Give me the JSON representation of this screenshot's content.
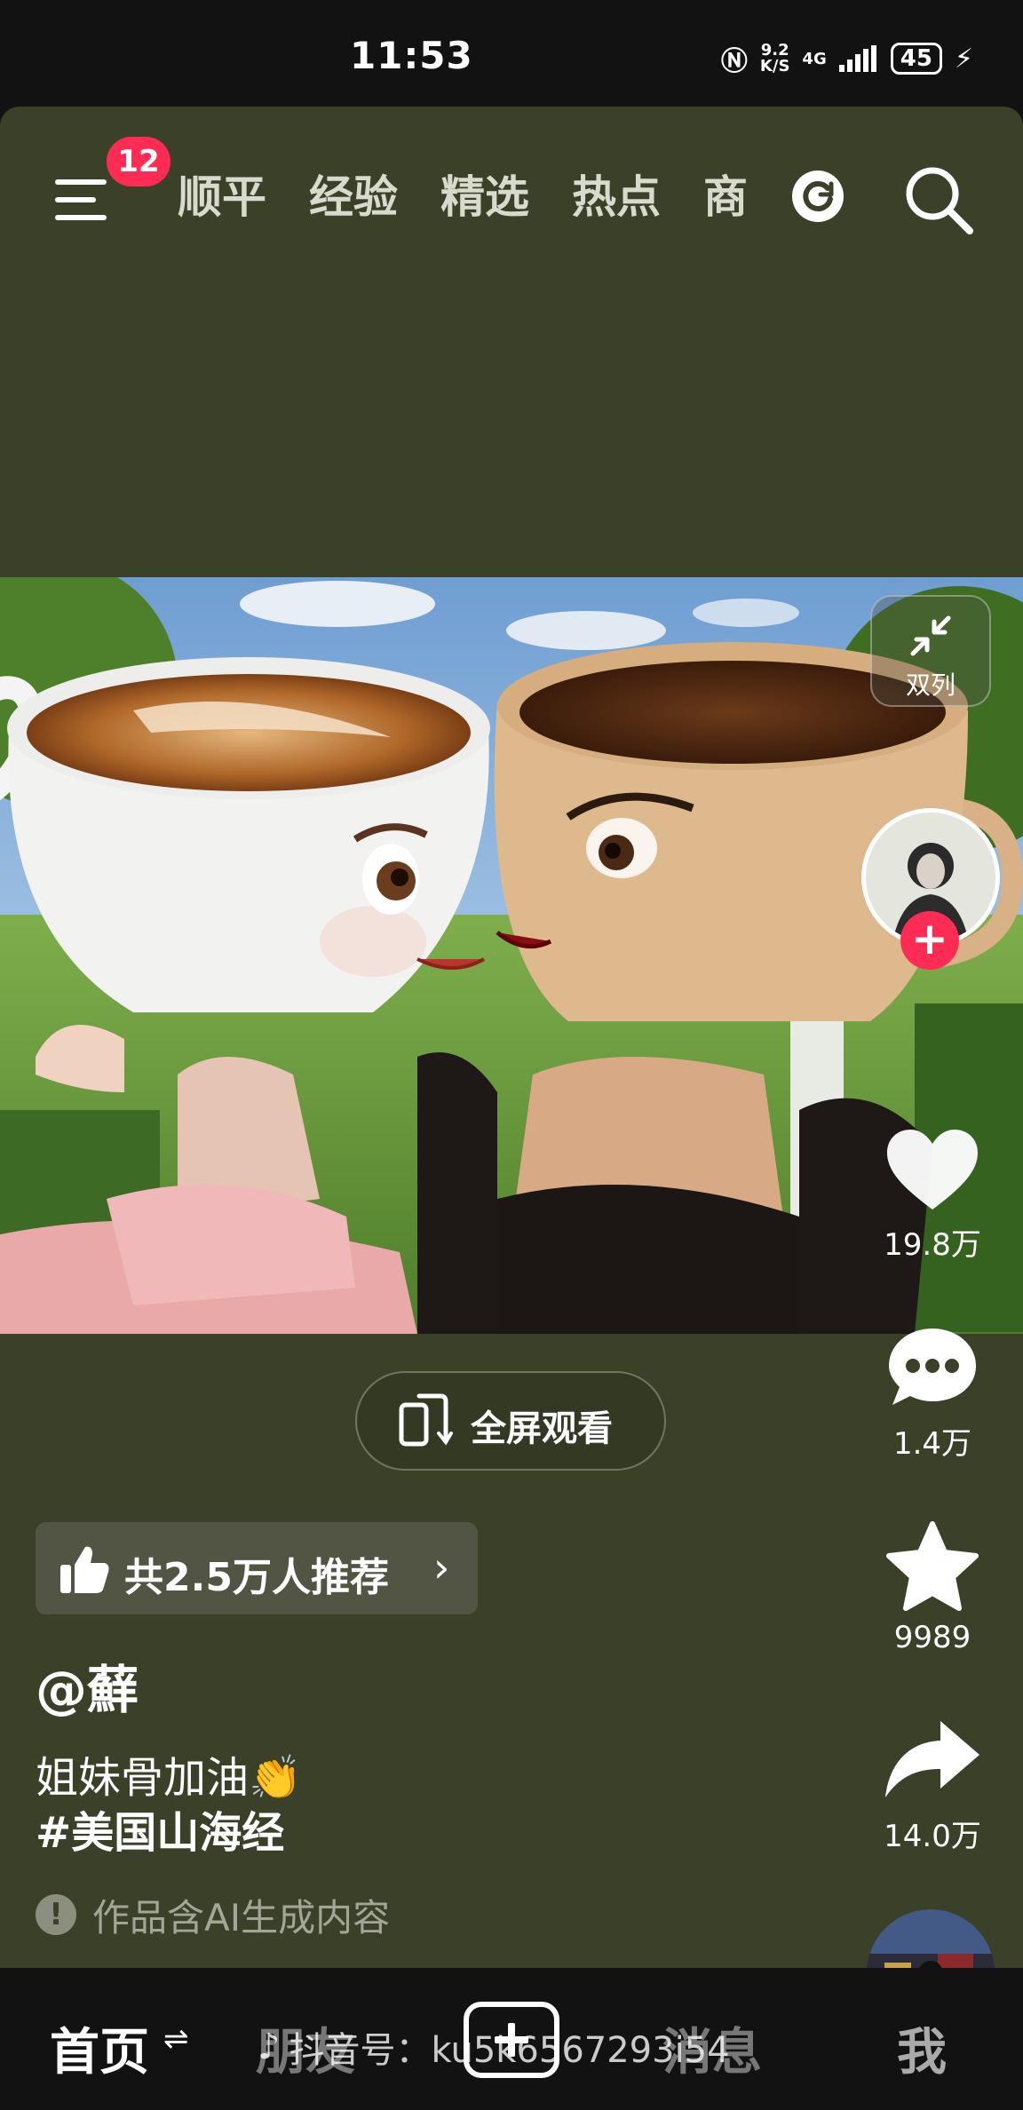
{
  "status_bar": {
    "time": "11:53",
    "net_speed_value": "9.2",
    "net_speed_unit": "K/S",
    "network": "4G",
    "battery": "45"
  },
  "top_nav": {
    "badge_count": "12",
    "tabs": [
      "顺平",
      "经验",
      "精选",
      "热点",
      "商"
    ]
  },
  "side_actions": {
    "dual_column_label": "双列",
    "likes": "19.8万",
    "comments": "1.4万",
    "favorites": "9989",
    "shares": "14.0万"
  },
  "fullscreen_label": "全屏观看",
  "recommend_text": "共2.5万人推荐",
  "author": "@蘚",
  "description": "姐妹骨加油👏",
  "hashtag": "#美国山海经",
  "ai_notice": "作品含AI生成内容",
  "progress": 0.5,
  "bottom_nav": {
    "home": "首页",
    "friends": "朋友",
    "messages": "消息",
    "me": "我"
  },
  "watermark": "抖音号：ku5k6567293i54",
  "colors": {
    "background": "#3b4129",
    "accent": "#fe2c55",
    "status_bar": "#121212"
  },
  "icons": [
    "menu-icon",
    "refresh-icon",
    "search-icon",
    "collapse-arrows-icon",
    "heart-icon",
    "comment-icon",
    "star-icon",
    "share-icon",
    "thumbs-up-icon",
    "fullscreen-phone-icon",
    "warning-icon",
    "plus-icon",
    "tiktok-logo-icon"
  ]
}
